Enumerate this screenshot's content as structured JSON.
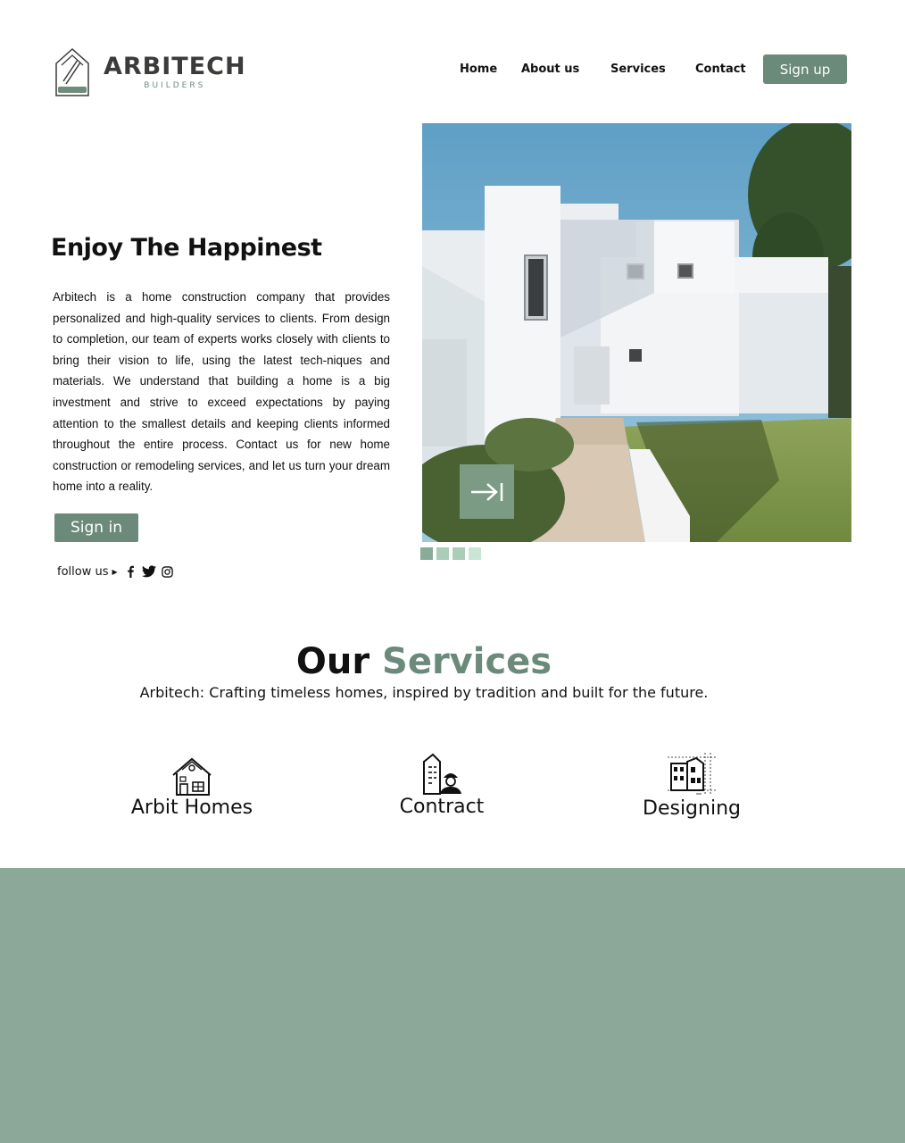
{
  "brand": {
    "name": "ARBITECH",
    "tagline": "BUILDERS"
  },
  "nav": {
    "home": "Home",
    "about": "About us",
    "services": "Services",
    "contact": "Contact",
    "signup": "Sign up"
  },
  "hero": {
    "title": "Enjoy The Happinest",
    "description": "Arbitech is a home construction company that provides personalized and high-quality services to clients. From design to completion, our team of experts works closely with clients to bring their vision to life, using the latest tech-niques and materials. We understand that building a home is a big investment and strive to exceed expectations by paying attention to the smallest details and keeping clients informed throughout the entire process. Contact us for new home construction or remodeling services, and let us turn your dream home into a reality.",
    "signin": "Sign in",
    "follow_label": "follow us",
    "social_icons": [
      "facebook-icon",
      "twitter-icon",
      "instagram-icon"
    ],
    "carousel_slides": 4,
    "carousel_active": 1
  },
  "services": {
    "title_part1": "Our",
    "title_part2": "Services",
    "subtitle": "Arbitech: Crafting timeless homes, inspired by tradition and built for the future.",
    "items": [
      {
        "label": "Arbit Homes",
        "icon": "house-icon"
      },
      {
        "label": "Contract",
        "icon": "builder-icon"
      },
      {
        "label": "Designing",
        "icon": "blueprint-icon"
      }
    ]
  },
  "colors": {
    "accent": "#6b8a79",
    "band": "#8ca898",
    "dot_dark": "#8aab97",
    "dot_mid": "#a9cdb6",
    "dot_light": "#c8e6d3"
  }
}
